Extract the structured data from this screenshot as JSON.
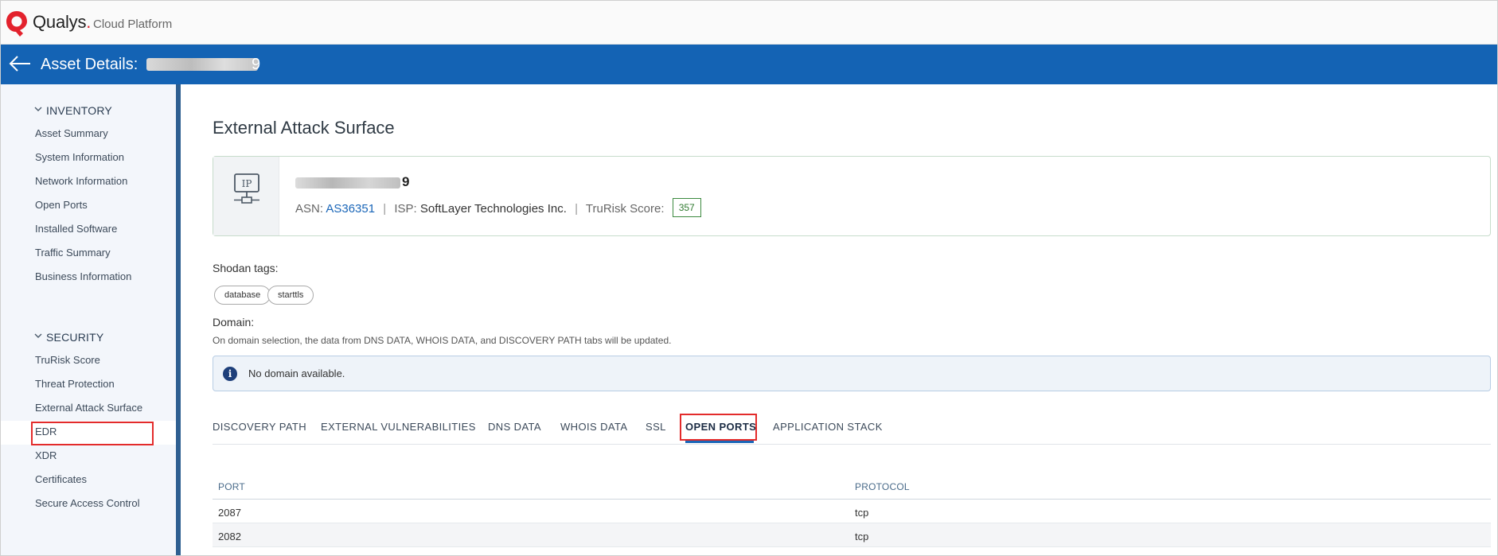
{
  "header": {
    "brand": "Qualys",
    "brand_dot": ".",
    "platform": "Cloud Platform"
  },
  "asset_bar": {
    "title": "Asset Details:",
    "id_visible_tail": "9"
  },
  "sidebar": {
    "inventory": {
      "heading": "INVENTORY",
      "items": [
        "Asset Summary",
        "System Information",
        "Network Information",
        "Open Ports",
        "Installed Software",
        "Traffic Summary",
        "Business Information"
      ]
    },
    "security": {
      "heading": "SECURITY",
      "items": [
        "TruRisk Score",
        "Threat Protection",
        "External Attack Surface",
        "EDR",
        "XDR",
        "Certificates",
        "Secure Access Control"
      ]
    }
  },
  "main": {
    "page_title": "External Attack Surface",
    "ip_card": {
      "icon_label": "IP",
      "ip_visible_tail": "9",
      "asn_label": "ASN:",
      "asn_value": "AS36351",
      "isp_label": "ISP:",
      "isp_value": "SoftLayer Technologies Inc.",
      "trurisk_label": "TruRisk Score:",
      "trurisk_value": "357",
      "separator": "|"
    },
    "shodan": {
      "label": "Shodan tags:",
      "tags": [
        "database",
        "starttls"
      ]
    },
    "domain": {
      "label": "Domain:",
      "hint": "On domain selection, the data from DNS DATA, WHOIS DATA, and DISCOVERY PATH tabs will be updated.",
      "info_message": "No domain available."
    },
    "tabs": [
      "DISCOVERY PATH",
      "EXTERNAL VULNERABILITIES",
      "DNS DATA",
      "WHOIS DATA",
      "SSL",
      "OPEN PORTS",
      "APPLICATION STACK"
    ],
    "active_tab": "OPEN PORTS",
    "ports_table": {
      "columns": [
        "PORT",
        "PROTOCOL"
      ],
      "rows": [
        {
          "port": "2087",
          "protocol": "tcp"
        },
        {
          "port": "2082",
          "protocol": "tcp"
        }
      ]
    }
  },
  "colors": {
    "asset_bar": "#1463b4",
    "sidebar_bg": "#f3f6fb",
    "sidebar_rail": "#2e5f91",
    "link": "#1a66b8",
    "score_badge": "#3c8a3f",
    "highlight": "#e32b2b",
    "brand_red": "#e3222d"
  },
  "icons": {
    "logo": "qualys-logo-icon",
    "back": "back-arrow-icon",
    "chevron": "chevron-down-icon",
    "ip": "ip-network-icon",
    "info": "info-icon"
  }
}
